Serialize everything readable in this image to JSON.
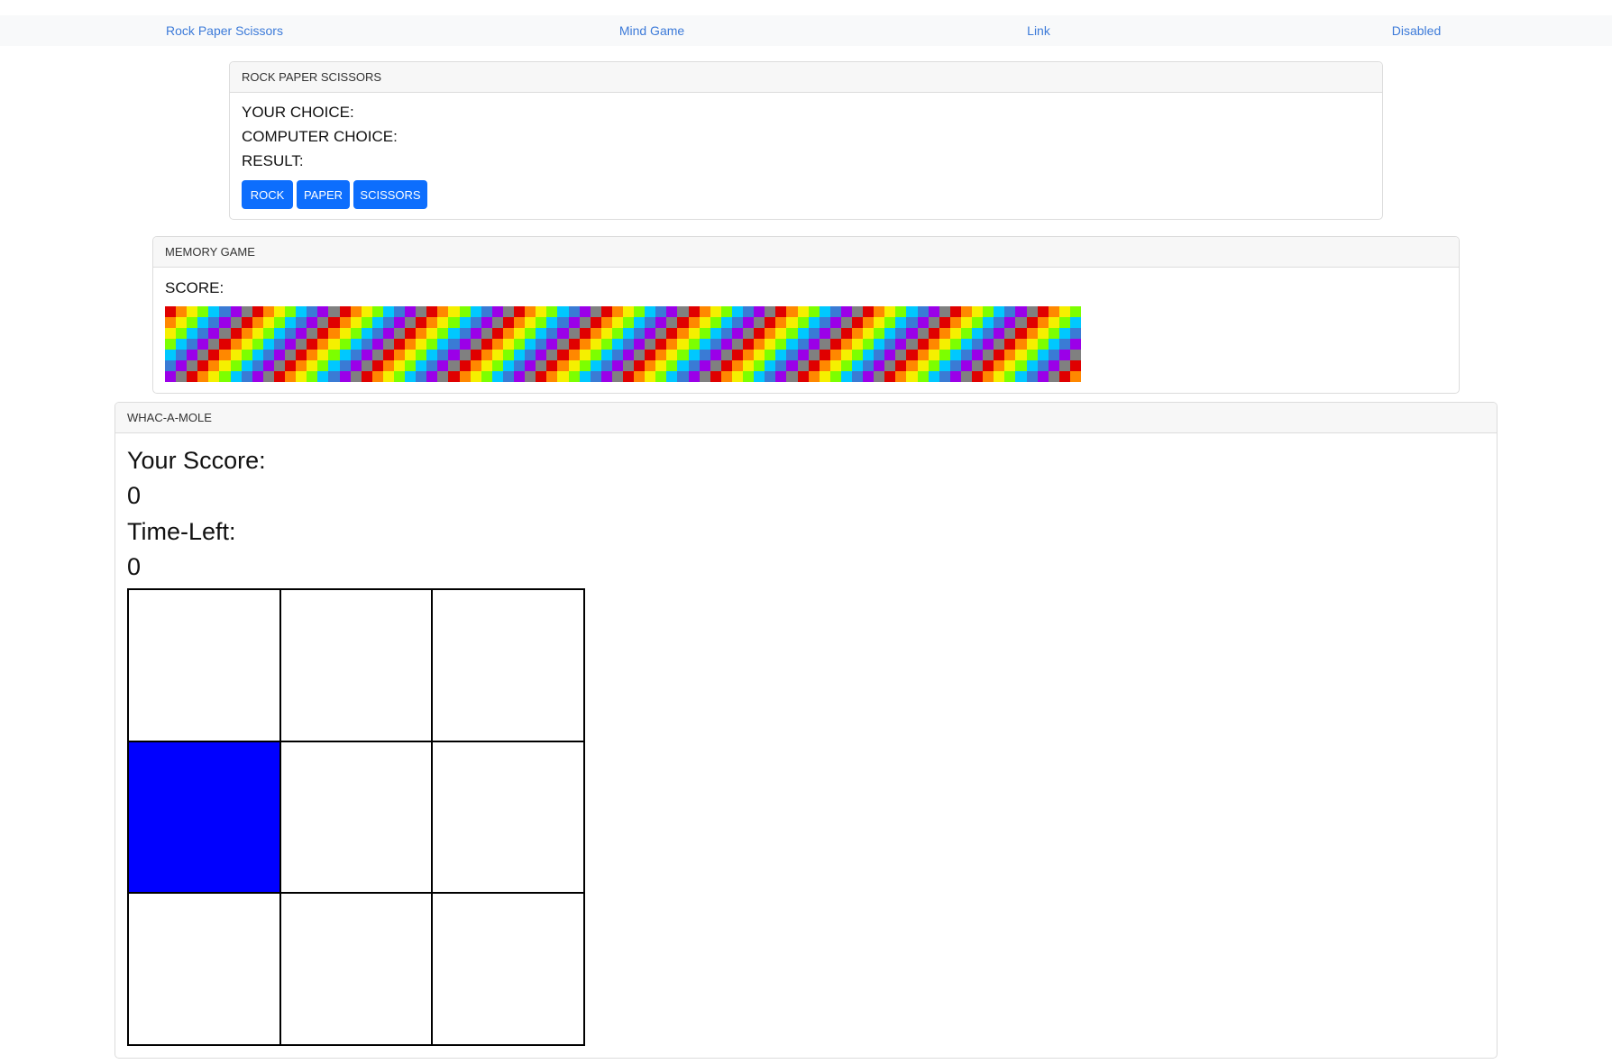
{
  "nav": {
    "items": [
      {
        "label": "Rock Paper Scissors"
      },
      {
        "label": "Mind Game"
      },
      {
        "label": "Link"
      },
      {
        "label": "Disabled"
      }
    ]
  },
  "rps": {
    "header": "ROCK PAPER SCISSORS",
    "your_choice_label": "YOUR CHOICE:",
    "computer_choice_label": "COMPUTER CHOICE:",
    "result_label": "RESULT:",
    "buttons": {
      "rock": "ROCK",
      "paper": "PAPER",
      "scissors": "SCISSORS"
    }
  },
  "memory": {
    "header": "MEMORY GAME",
    "score_label": "SCORE:",
    "tile_colors": [
      "#e00000",
      "#ff8800",
      "#f5f000",
      "#7cff00",
      "#00c8ff",
      "#3a7bd5",
      "#9b00e8",
      "#808080"
    ]
  },
  "whac": {
    "header": "WHAC-A-MOLE",
    "score_label": "Your Sccore:",
    "score_value": "0",
    "time_label": "Time-Left:",
    "time_value": "0",
    "mole_color": "#0000ff",
    "squares": [
      false,
      false,
      false,
      true,
      false,
      false,
      false,
      false,
      false
    ]
  }
}
